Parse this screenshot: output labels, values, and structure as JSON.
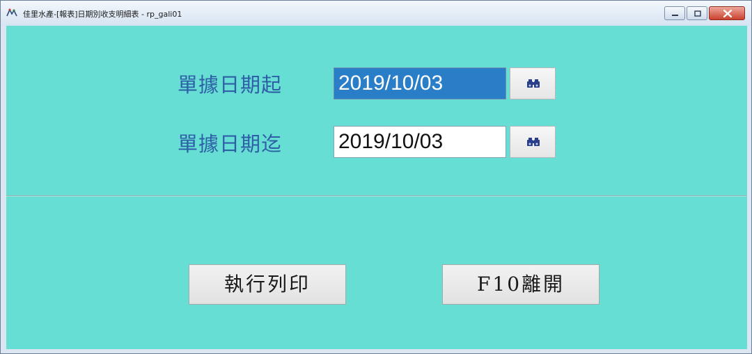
{
  "window": {
    "title": "佳里水產-[報表]日期別收支明細表 - rp_gali01"
  },
  "form": {
    "start_label": "單據日期起",
    "start_value": "2019/10/03",
    "end_label": "單據日期迄",
    "end_value": "2019/10/03"
  },
  "actions": {
    "print_label": "執行列印",
    "exit_label": "F10離開"
  },
  "colors": {
    "client_background": "#66ded4",
    "label_text": "#2e5ea6",
    "selection_highlight": "#2a7ec7",
    "close_button": "#c9412d"
  },
  "icons": {
    "app": "app-logo-icon",
    "lookup": "binoculars-icon"
  }
}
